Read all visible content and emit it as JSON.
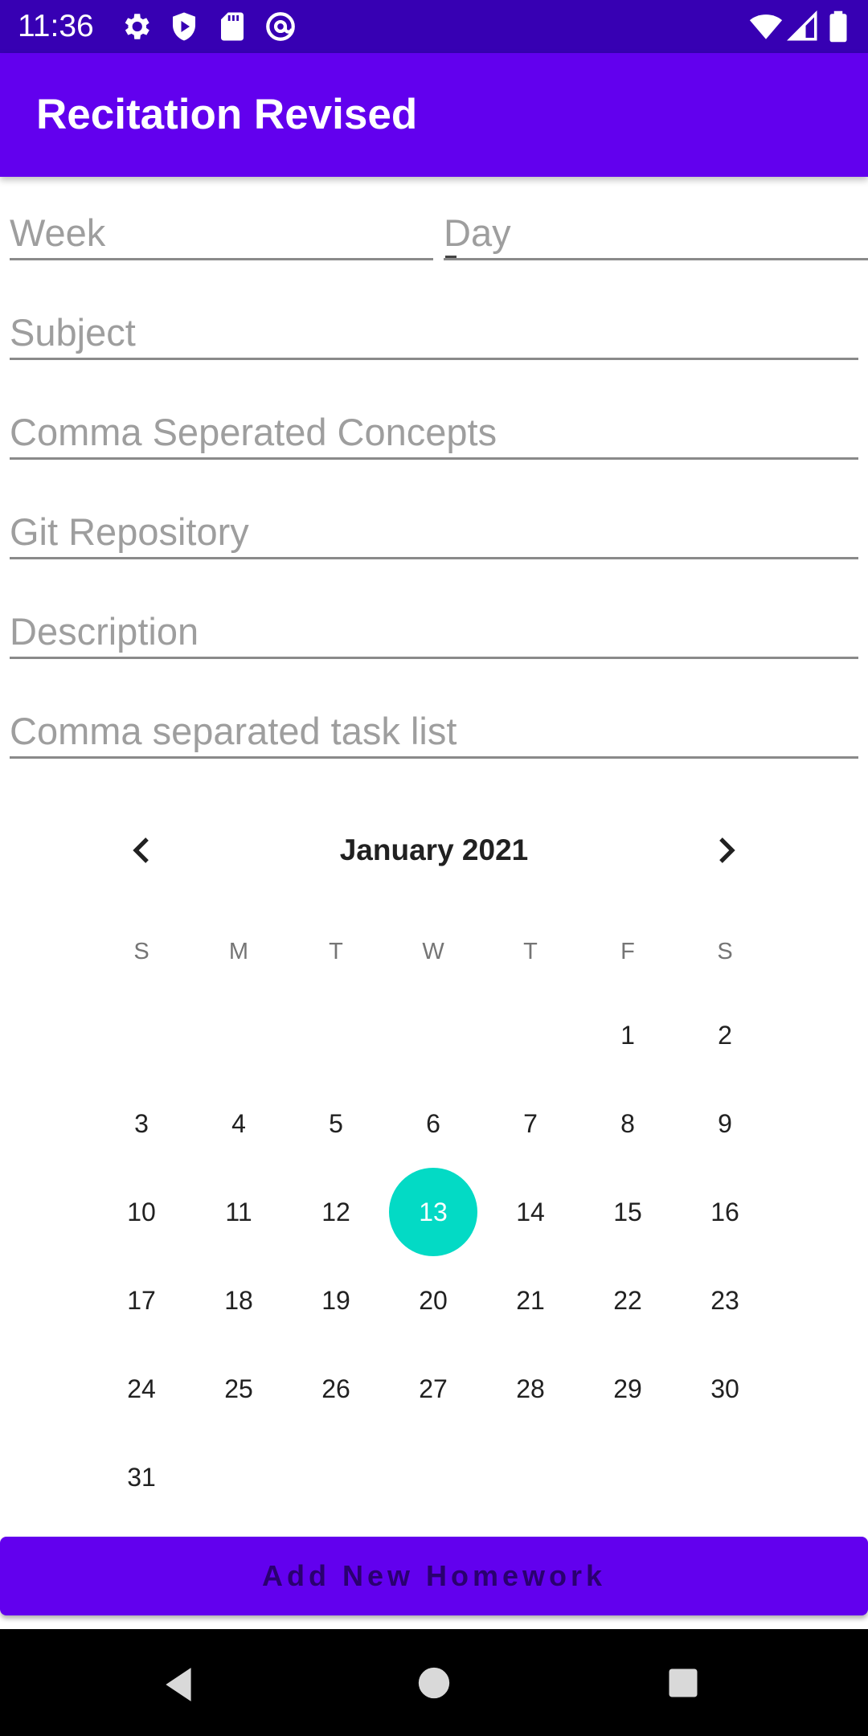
{
  "status_bar": {
    "time": "11:36",
    "left_icons": [
      "gear-icon",
      "shield-play-icon",
      "sd-card-icon",
      "at-sign-icon"
    ],
    "right_icons": [
      "wifi-icon",
      "signal-icon",
      "battery-icon"
    ]
  },
  "app_bar": {
    "title": "Recitation Revised",
    "color": "#6200ee"
  },
  "form": {
    "week_placeholder": "Week",
    "day_placeholder": "Day",
    "subject_placeholder": "Subject",
    "concepts_placeholder": "Comma Seperated Concepts",
    "git_placeholder": "Git Repository",
    "description_placeholder": "Description",
    "tasks_placeholder": "Comma separated task list"
  },
  "calendar": {
    "month_label": "January 2021",
    "weekdays": [
      "S",
      "M",
      "T",
      "W",
      "T",
      "F",
      "S"
    ],
    "first_weekday_index": 5,
    "days_in_month": 31,
    "selected_day": 13,
    "selected_color": "#03dac5",
    "prev_icon": "chevron-left-icon",
    "next_icon": "chevron-right-icon"
  },
  "actions": {
    "add_label": "Add New Homework"
  },
  "nav_bar": {
    "icons": [
      "back-icon",
      "home-icon",
      "recents-icon"
    ]
  }
}
